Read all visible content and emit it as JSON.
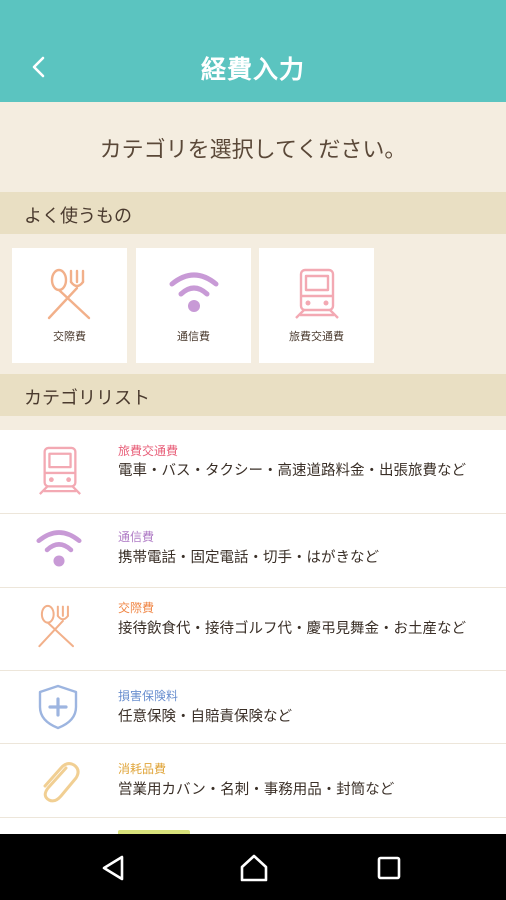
{
  "header": {
    "title": "経費入力",
    "back_icon": "chevron-left-icon"
  },
  "prompt": "カテゴリを選択してください。",
  "favorites": {
    "heading": "よく使うもの",
    "items": [
      {
        "label": "交際費",
        "icon": "fork-knife-icon",
        "color": "#f2b08a"
      },
      {
        "label": "通信費",
        "icon": "wifi-icon",
        "color": "#c89ad6"
      },
      {
        "label": "旅費交通費",
        "icon": "train-icon",
        "color": "#f3a9b3"
      }
    ]
  },
  "category_list": {
    "heading": "カテゴリリスト",
    "items": [
      {
        "name": "旅費交通費",
        "name_color": "#e8607a",
        "desc": "電車・バス・タクシー・高速道路料金・出張旅費など",
        "icon": "train-icon"
      },
      {
        "name": "通信費",
        "name_color": "#b07cc6",
        "desc": "携帯電話・固定電話・切手・はがきなど",
        "icon": "wifi-icon"
      },
      {
        "name": "交際費",
        "name_color": "#f08848",
        "desc": "接待飲食代・接待ゴルフ代・慶弔見舞金・お土産など",
        "icon": "fork-knife-icon"
      },
      {
        "name": "損害保険料",
        "name_color": "#6a8fcf",
        "desc": "任意保険・自賠責保険など",
        "icon": "shield-plus-icon"
      },
      {
        "name": "消耗品費",
        "name_color": "#e0a53a",
        "desc": "営業用カバン・名刺・事務用品・封筒など",
        "icon": "paperclip-icon"
      }
    ]
  },
  "navbar": {
    "back": "nav-back-icon",
    "home": "nav-home-icon",
    "recents": "nav-recents-icon"
  },
  "colors": {
    "header": "#5bc4c0",
    "background": "#f4ede0",
    "section": "#e9dfc3"
  }
}
